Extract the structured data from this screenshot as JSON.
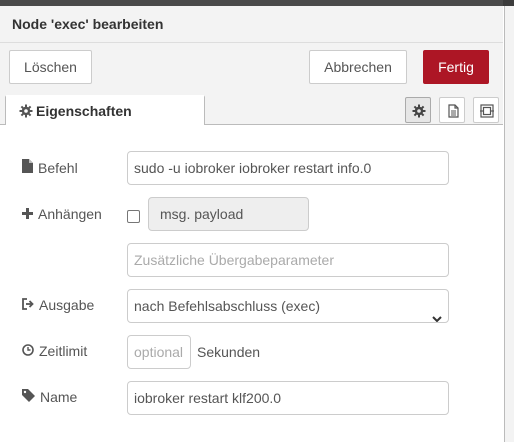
{
  "tray": {
    "title": "Node 'exec' bearbeiten"
  },
  "toolbar": {
    "delete_label": "Löschen",
    "cancel_label": "Abbrechen",
    "done_label": "Fertig"
  },
  "tabs": {
    "properties_label": "Eigenschaften",
    "active_icon": "gear-icon",
    "icons": [
      "gear-icon",
      "document-icon",
      "node-appearance-icon"
    ]
  },
  "form": {
    "command": {
      "label": "Befehl",
      "value": "sudo -u iobroker iobroker restart info.0",
      "icon": "file-icon"
    },
    "append": {
      "label": "Anhängen",
      "checked": false,
      "payload_value": "msg. payload",
      "extra_placeholder": "Zusätzliche Übergabeparameter",
      "icon": "plus-icon"
    },
    "output": {
      "label": "Ausgabe",
      "selected": "nach Befehlsabschluss (exec)",
      "icon": "sign-out-icon"
    },
    "timeout": {
      "label": "Zeitlimit",
      "placeholder": "optional",
      "unit": "Sekunden",
      "icon": "clock-icon"
    },
    "name": {
      "label": "Name",
      "value": "iobroker restart klf200.0",
      "icon": "tag-icon"
    }
  },
  "colors": {
    "primary_button": "#ad1625",
    "header_bg": "#f3f3f3",
    "border": "#cccccc"
  }
}
